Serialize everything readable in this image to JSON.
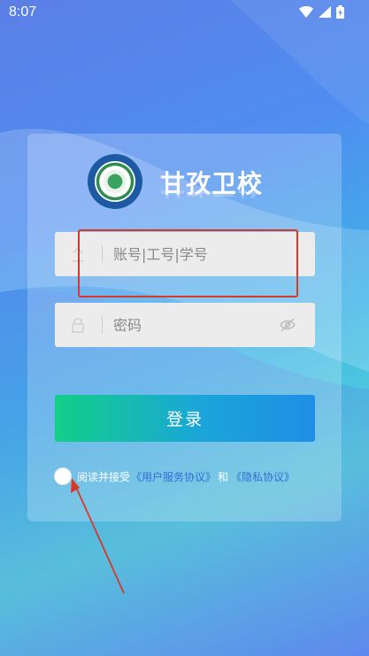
{
  "status": {
    "time": "8:07",
    "icons": [
      "wifi-icon",
      "signal-icon",
      "battery-icon"
    ]
  },
  "school": {
    "name": "甘孜卫校",
    "logo": "school-emblem"
  },
  "form": {
    "account_placeholder": "账号|工号|学号",
    "password_placeholder": "密码",
    "login_label": "登录"
  },
  "agreement": {
    "prefix": "阅读并接受",
    "user_agreement": "《用户服务协议》",
    "and": "和",
    "privacy_policy": "《隐私协议》"
  },
  "colors": {
    "highlight": "#d43a2a",
    "button_start": "#12cf86",
    "button_end": "#1f8ee6",
    "link": "#2f6fd6"
  }
}
